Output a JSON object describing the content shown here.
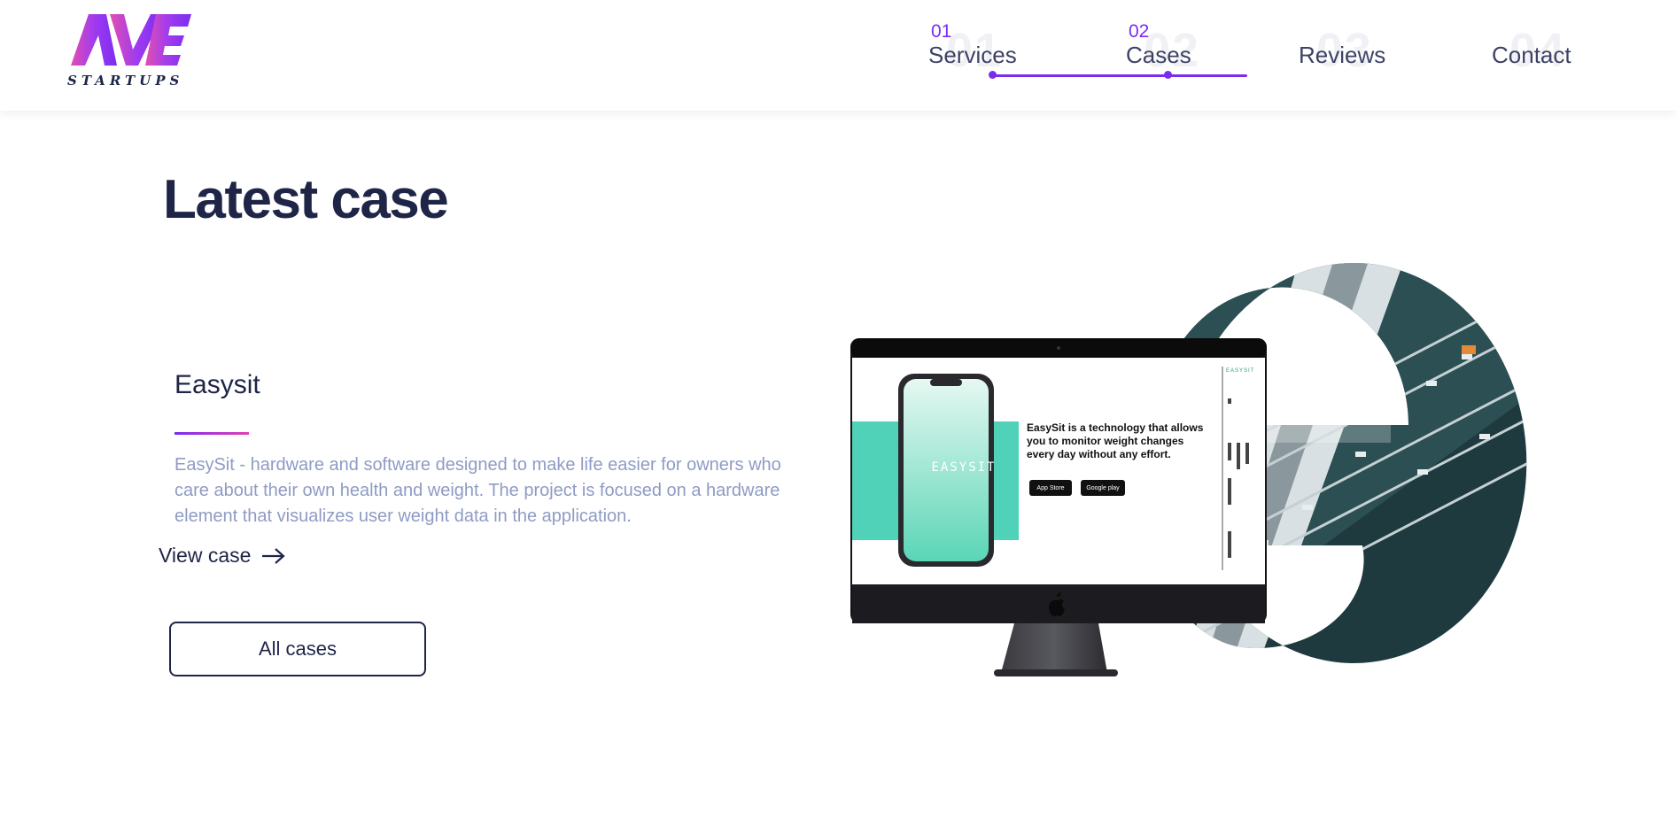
{
  "brand": {
    "logo_subtext": "STARTUPS"
  },
  "nav": [
    {
      "num": "01",
      "label": "Services",
      "bg": "01",
      "active": true
    },
    {
      "num": "02",
      "label": "Cases",
      "bg": "02",
      "active": true
    },
    {
      "num": "",
      "label": "Reviews",
      "bg": "03",
      "active": false
    },
    {
      "num": "",
      "label": "Contact",
      "bg": "04",
      "active": false
    }
  ],
  "main": {
    "title": "Latest case",
    "case_name": "Easysit",
    "case_description": "EasySit - hardware and software designed to make life easier for owners who care about their own health and weight. The project is focused on a hardware element that visualizes user weight data in the application.",
    "view_case_label": "View case",
    "all_cases_label": "All cases"
  },
  "mockup": {
    "phone_brand": "EASYSIT",
    "screen_tagline": "EasySit is a technology that allows you to monitor weight changes every day without any effort.",
    "app_store_label": "App Store",
    "google_play_label": "Google play",
    "mini_brand": "EASYSIT"
  },
  "colors": {
    "accent": "#7b2cf0",
    "gradient_end": "#e23fb5",
    "navy": "#1f2547",
    "muted_text": "#8f9bc4",
    "teal": "#4fd2b8"
  }
}
